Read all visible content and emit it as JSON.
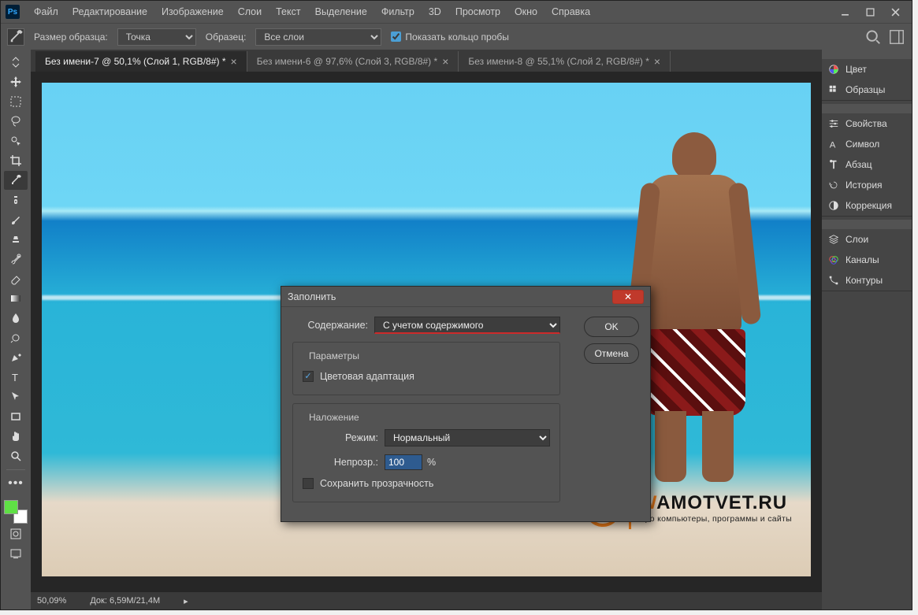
{
  "menu": {
    "items": [
      "Файл",
      "Редактирование",
      "Изображение",
      "Слои",
      "Текст",
      "Выделение",
      "Фильтр",
      "3D",
      "Просмотр",
      "Окно",
      "Справка"
    ]
  },
  "options": {
    "size_label": "Размер образца:",
    "size_value": "Точка",
    "sample_label": "Образец:",
    "sample_value": "Все слои",
    "show_ring_label": "Показать кольцо пробы",
    "show_ring_checked": true
  },
  "tabs": [
    {
      "label": "Без имени-7 @ 50,1% (Слой 1, RGB/8#) *",
      "active": true
    },
    {
      "label": "Без имени-6 @ 97,6% (Слой 3, RGB/8#) *",
      "active": false
    },
    {
      "label": "Без имени-8 @ 55,1% (Слой 2, RGB/8#) *",
      "active": false
    }
  ],
  "panels": {
    "color": "Цвет",
    "swatches": "Образцы",
    "properties": "Свойства",
    "character": "Символ",
    "paragraph": "Абзац",
    "history": "История",
    "adjustments": "Коррекция",
    "layers": "Слои",
    "channels": "Каналы",
    "paths": "Контуры"
  },
  "status": {
    "zoom": "50,09%",
    "doc_label": "Док:",
    "doc_size": "6,59M/21,4M"
  },
  "dialog": {
    "title": "Заполнить",
    "content_label": "Содержание:",
    "content_value": "С учетом содержимого",
    "ok": "OK",
    "cancel": "Отмена",
    "params_group": "Параметры",
    "color_adapt_label": "Цветовая адаптация",
    "color_adapt_checked": true,
    "blending_group": "Наложение",
    "mode_label": "Режим:",
    "mode_value": "Нормальный",
    "opacity_label": "Непрозр.:",
    "opacity_value": "100",
    "opacity_unit": "%",
    "preserve_label": "Сохранить прозрачность",
    "preserve_checked": false
  },
  "watermark": {
    "main": "WAMOTVET.RU",
    "sub": "Про компьютеры, программы и сайты"
  }
}
